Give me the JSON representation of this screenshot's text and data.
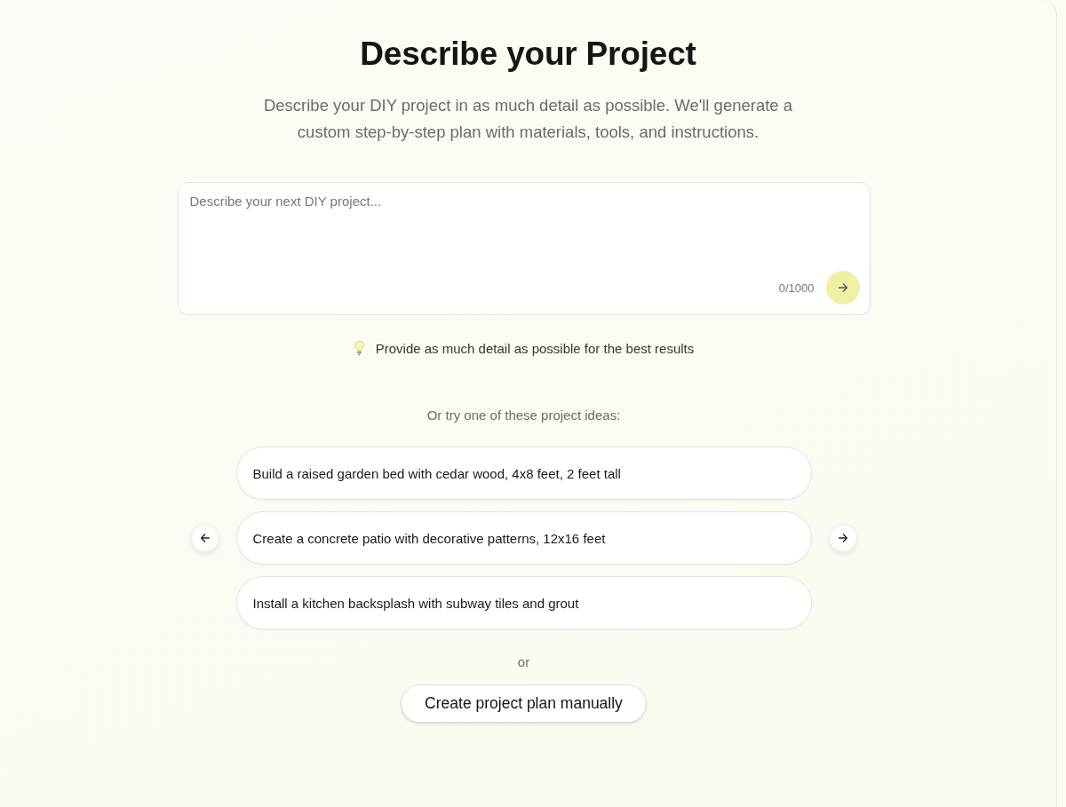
{
  "header": {
    "title": "Describe your Project",
    "subtitle": "Describe your DIY project in as much detail as possible. We'll generate a custom step-by-step plan with materials, tools, and instructions."
  },
  "prompt": {
    "placeholder": "Describe your next DIY project...",
    "counter": "0/1000"
  },
  "tip": "Provide as much detail as possible for the best results",
  "ideas_heading": "Or try one of these project ideas:",
  "ideas": [
    {
      "text": "Build a raised garden bed with cedar wood, 4x8 feet, 2 feet tall"
    },
    {
      "text": "Create a concrete patio with decorative patterns, 12x16 feet"
    },
    {
      "text": "Install a kitchen backsplash with subway tiles and grout"
    }
  ],
  "separator": "or",
  "manual_button": "Create project plan manually"
}
